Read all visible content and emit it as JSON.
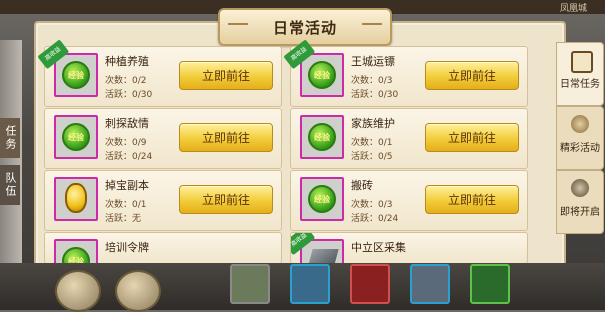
{
  "top_bar": {
    "left_text": "",
    "mid_text": "",
    "right_text": "凤凰城"
  },
  "side_tabs": {
    "task": "任务",
    "team": "队伍"
  },
  "panel": {
    "title": "日常活动"
  },
  "cards": [
    {
      "name": "种植养殖",
      "count": "次数：0/2",
      "active": "活跃：0/30",
      "button": "立即前往",
      "badge": "高收益",
      "icon": "exp-coin-icon"
    },
    {
      "name": "王城运镖",
      "count": "次数：0/3",
      "active": "活跃：0/30",
      "button": "立即前往",
      "badge": "高收益",
      "icon": "exp-coin-icon"
    },
    {
      "name": "刺探敌情",
      "count": "次数：0/9",
      "active": "活跃：0/24",
      "button": "立即前往",
      "badge": "",
      "icon": "exp-coin-icon"
    },
    {
      "name": "家族维护",
      "count": "次数：0/1",
      "active": "活跃：0/5",
      "button": "立即前往",
      "badge": "",
      "icon": "exp-coin-icon"
    },
    {
      "name": "掉宝副本",
      "count": "次数：0/1",
      "active": "活跃：无",
      "button": "立即前往",
      "badge": "",
      "icon": "yellow-gem-icon"
    },
    {
      "name": "搬砖",
      "count": "次数：0/3",
      "active": "活跃：0/24",
      "button": "立即前往",
      "badge": "",
      "icon": "exp-coin-icon"
    },
    {
      "name": "培训令牌",
      "count": "",
      "active": "",
      "button": "",
      "badge": "",
      "icon": "exp-coin-icon"
    },
    {
      "name": "中立区采集",
      "count": "",
      "active": "",
      "button": "",
      "badge": "高收益",
      "icon": "ore-icon"
    }
  ],
  "right_tabs": [
    {
      "label": "日常任务",
      "icon": "scroll-icon",
      "active": true
    },
    {
      "label": "精彩活动",
      "icon": "medal-icon",
      "active": false
    },
    {
      "label": "即将开启",
      "icon": "gong-icon",
      "active": false
    }
  ],
  "colors": {
    "button": "#f2cc3a",
    "icon_border": "#cc2aa8",
    "badge": "#2f9a39",
    "panel": "#eee3cb"
  }
}
